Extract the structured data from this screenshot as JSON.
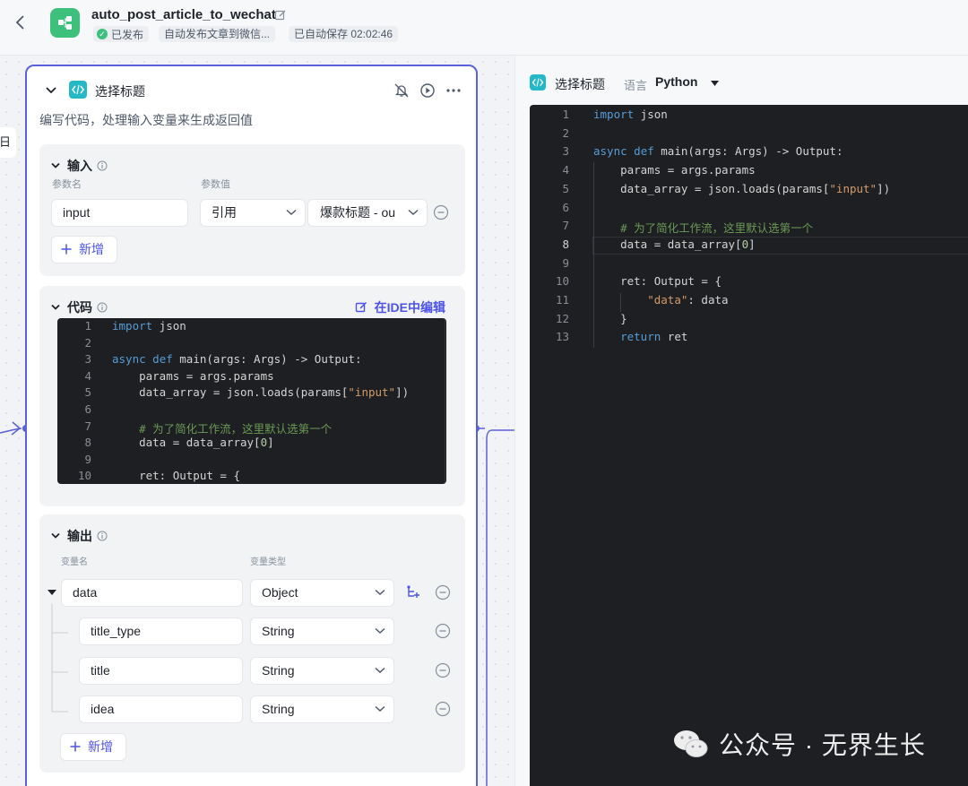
{
  "header": {
    "title": "auto_post_article_to_wechat",
    "status": "已发布",
    "description": "自动发布文章到微信...",
    "autosave": "已自动保存 02:02:46"
  },
  "left_stub": "日",
  "node": {
    "title": "选择标题",
    "description": "编写代码，处理输入变量来生成返回值",
    "input_section": {
      "label": "输入",
      "col_name": "参数名",
      "col_value": "参数值",
      "param_name": "input",
      "ref_type": "引用",
      "ref_value": "爆款标题 - ou",
      "add_label": "新增"
    },
    "code_section": {
      "label": "代码",
      "ide_label": "在IDE中编辑",
      "lines": [
        {
          "n": "1",
          "t": "import json"
        },
        {
          "n": "2",
          "t": ""
        },
        {
          "n": "3",
          "t": "async def main(args: Args) -> Output:"
        },
        {
          "n": "4",
          "t": "    params = args.params"
        },
        {
          "n": "5",
          "t": "    data_array = json.loads(params[\"input\"])"
        },
        {
          "n": "6",
          "t": ""
        },
        {
          "n": "7",
          "t": "    # 为了简化工作流，这里默认选第一个"
        },
        {
          "n": "8",
          "t": "    data = data_array[0]"
        },
        {
          "n": "9",
          "t": ""
        },
        {
          "n": "10",
          "t": "    ret: Output = {"
        }
      ]
    },
    "output_section": {
      "label": "输出",
      "col_name": "变量名",
      "col_type": "变量类型",
      "rows": [
        {
          "name": "data",
          "type": "Object"
        },
        {
          "name": "title_type",
          "type": "String"
        },
        {
          "name": "title",
          "type": "String"
        },
        {
          "name": "idea",
          "type": "String"
        }
      ],
      "add_label": "新增"
    }
  },
  "ide_panel": {
    "title": "选择标题",
    "lang_label": "语言",
    "language": "Python",
    "active_line": 8,
    "lines": [
      {
        "n": "1",
        "t": "import json"
      },
      {
        "n": "2",
        "t": ""
      },
      {
        "n": "3",
        "t": "async def main(args: Args) -> Output:"
      },
      {
        "n": "4",
        "t": "    params = args.params"
      },
      {
        "n": "5",
        "t": "    data_array = json.loads(params[\"input\"])"
      },
      {
        "n": "6",
        "t": ""
      },
      {
        "n": "7",
        "t": "    # 为了简化工作流，这里默认选第一个"
      },
      {
        "n": "8",
        "t": "    data = data_array[0]"
      },
      {
        "n": "9",
        "t": ""
      },
      {
        "n": "10",
        "t": "    ret: Output = {"
      },
      {
        "n": "11",
        "t": "        \"data\": data"
      },
      {
        "n": "12",
        "t": "    }"
      },
      {
        "n": "13",
        "t": "    return ret"
      }
    ]
  },
  "watermark": "公众号 · 无界生长",
  "colors": {
    "accent": "#4d53e8",
    "node_border": "#5a62d9",
    "code_icon": "#24b8c8",
    "published": "#3ec07d",
    "editor_bg": "#1e1f22"
  }
}
